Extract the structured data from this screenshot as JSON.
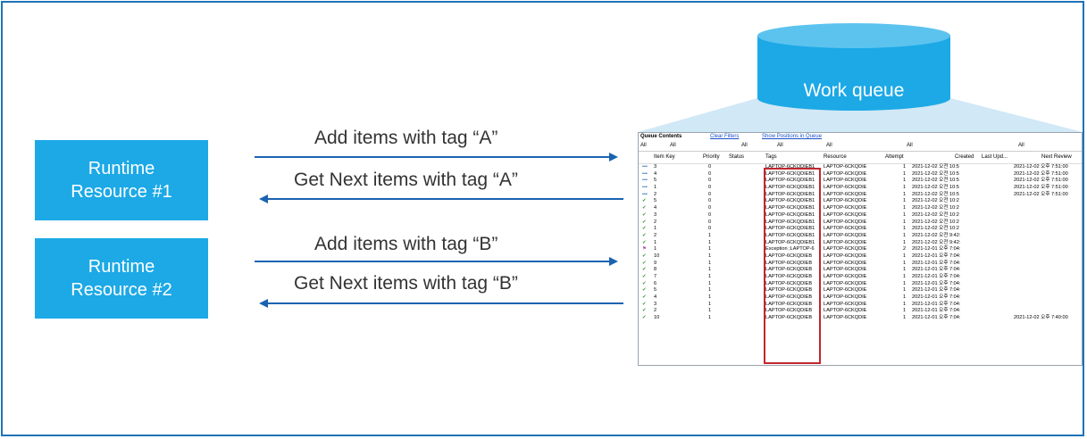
{
  "resources": [
    {
      "label_line1": "Runtime",
      "label_line2": "Resource #1"
    },
    {
      "label_line1": "Runtime",
      "label_line2": "Resource #2"
    }
  ],
  "arrows": [
    {
      "label": "Add items with tag “A”",
      "direction": "right"
    },
    {
      "label": "Get Next items with tag “A”",
      "direction": "left"
    },
    {
      "label": "Add items with tag “B”",
      "direction": "right"
    },
    {
      "label": "Get Next items with tag “B”",
      "direction": "left"
    }
  ],
  "queue": {
    "title": "Work queue",
    "window": {
      "heading": "Queue Contents",
      "clear_filters": "Clear Filters",
      "show_positions": "Show Positions in Queue",
      "filter_all": "All",
      "columns": [
        "Item Key",
        "Priority",
        "Status",
        "Tags",
        "Resource",
        "Attempt",
        "Created",
        "Last Upd...",
        "Next Review"
      ],
      "rows": [
        {
          "icon": "dots",
          "key": "3",
          "priority": "0",
          "tags": "LAPTOP-6CKQDIEB1",
          "resource": "LAPTOP-6CKQDIE",
          "attempt": "1",
          "created": "2021-12-02 오전 10:5",
          "next": "2021-12-02 오후 7:51:00"
        },
        {
          "icon": "dots",
          "key": "4",
          "priority": "0",
          "tags": "LAPTOP-6CKQDIEB1",
          "resource": "LAPTOP-6CKQDIE",
          "attempt": "1",
          "created": "2021-12-02 오전 10:5",
          "next": "2021-12-02 오후 7:51:00"
        },
        {
          "icon": "dots",
          "key": "5",
          "priority": "0",
          "tags": "LAPTOP-6CKQDIEB1",
          "resource": "LAPTOP-6CKQDIE",
          "attempt": "1",
          "created": "2021-12-02 오전 10:5",
          "next": "2021-12-02 오후 7:51:00"
        },
        {
          "icon": "dots",
          "key": "1",
          "priority": "0",
          "tags": "LAPTOP-6CKQDIEB1",
          "resource": "LAPTOP-6CKQDIE",
          "attempt": "1",
          "created": "2021-12-02 오전 10:5",
          "next": "2021-12-02 오후 7:51:00"
        },
        {
          "icon": "dots",
          "key": "2",
          "priority": "0",
          "tags": "LAPTOP-6CKQDIEB1",
          "resource": "LAPTOP-6CKQDIE",
          "attempt": "1",
          "created": "2021-12-02 오전 10:5",
          "next": "2021-12-02 오후 7:51:00"
        },
        {
          "icon": "check",
          "key": "5",
          "priority": "0",
          "tags": "LAPTOP-6CKQDIEB1",
          "resource": "LAPTOP-6CKQDIE",
          "attempt": "1",
          "created": "2021-12-02 오전 10:2",
          "next": ""
        },
        {
          "icon": "check",
          "key": "4",
          "priority": "0",
          "tags": "LAPTOP-6CKQDIEB1",
          "resource": "LAPTOP-6CKQDIE",
          "attempt": "1",
          "created": "2021-12-02 오전 10:2",
          "next": ""
        },
        {
          "icon": "check",
          "key": "3",
          "priority": "0",
          "tags": "LAPTOP-6CKQDIEB1",
          "resource": "LAPTOP-6CKQDIE",
          "attempt": "1",
          "created": "2021-12-02 오전 10:2",
          "next": ""
        },
        {
          "icon": "check",
          "key": "2",
          "priority": "0",
          "tags": "LAPTOP-6CKQDIEB1",
          "resource": "LAPTOP-6CKQDIE",
          "attempt": "1",
          "created": "2021-12-02 오전 10:2",
          "next": ""
        },
        {
          "icon": "check",
          "key": "1",
          "priority": "0",
          "tags": "LAPTOP-6CKQDIEB1",
          "resource": "LAPTOP-6CKQDIE",
          "attempt": "1",
          "created": "2021-12-02 오전 10:2",
          "next": ""
        },
        {
          "icon": "check",
          "key": "2",
          "priority": "1",
          "tags": "LAPTOP-6CKQDIEB1",
          "resource": "LAPTOP-6CKQDIE",
          "attempt": "1",
          "created": "2021-12-02 오전 9:42:",
          "next": ""
        },
        {
          "icon": "check",
          "key": "1",
          "priority": "1",
          "tags": "LAPTOP-6CKQDIEB1",
          "resource": "LAPTOP-6CKQDIE",
          "attempt": "1",
          "created": "2021-12-02 오전 9:42:",
          "next": ""
        },
        {
          "icon": "flag",
          "key": "1",
          "priority": "1",
          "tags": "Exception ;LAPTOP-6",
          "resource": "LAPTOP-6CKQDIE",
          "attempt": "2",
          "created": "2021-12-01 오후 7:04:",
          "next": ""
        },
        {
          "icon": "check",
          "key": "10",
          "priority": "1",
          "tags": "LAPTOP-6CKQDIEB",
          "resource": "LAPTOP-6CKQDIE",
          "attempt": "1",
          "created": "2021-12-01 오후 7:04:",
          "next": ""
        },
        {
          "icon": "check",
          "key": "9",
          "priority": "1",
          "tags": "LAPTOP-6CKQDIEB",
          "resource": "LAPTOP-6CKQDIE",
          "attempt": "1",
          "created": "2021-12-01 오후 7:04:",
          "next": ""
        },
        {
          "icon": "check",
          "key": "8",
          "priority": "1",
          "tags": "LAPTOP-6CKQDIEB",
          "resource": "LAPTOP-6CKQDIE",
          "attempt": "1",
          "created": "2021-12-01 오후 7:04:",
          "next": ""
        },
        {
          "icon": "check",
          "key": "7",
          "priority": "1",
          "tags": "LAPTOP-6CKQDIEB",
          "resource": "LAPTOP-6CKQDIE",
          "attempt": "1",
          "created": "2021-12-01 오후 7:04:",
          "next": ""
        },
        {
          "icon": "check",
          "key": "6",
          "priority": "1",
          "tags": "LAPTOP-6CKQDIEB",
          "resource": "LAPTOP-6CKQDIE",
          "attempt": "1",
          "created": "2021-12-01 오후 7:04:",
          "next": ""
        },
        {
          "icon": "check",
          "key": "5",
          "priority": "1",
          "tags": "LAPTOP-6CKQDIEB",
          "resource": "LAPTOP-6CKQDIE",
          "attempt": "1",
          "created": "2021-12-01 오후 7:04:",
          "next": ""
        },
        {
          "icon": "check",
          "key": "4",
          "priority": "1",
          "tags": "LAPTOP-6CKQDIEB",
          "resource": "LAPTOP-6CKQDIE",
          "attempt": "1",
          "created": "2021-12-01 오후 7:04:",
          "next": ""
        },
        {
          "icon": "check",
          "key": "3",
          "priority": "1",
          "tags": "LAPTOP-6CKQDIEB",
          "resource": "LAPTOP-6CKQDIE",
          "attempt": "1",
          "created": "2021-12-01 오후 7:04:",
          "next": ""
        },
        {
          "icon": "check",
          "key": "2",
          "priority": "1",
          "tags": "LAPTOP-6CKQDIEB",
          "resource": "LAPTOP-6CKQDIE",
          "attempt": "1",
          "created": "2021-12-01 오후 7:04:",
          "next": ""
        },
        {
          "icon": "check",
          "key": "10",
          "priority": "1",
          "tags": "LAPTOP-6CKQDIEB",
          "resource": "LAPTOP-6CKQDIE",
          "attempt": "1",
          "created": "2021-12-01 오후 7:04:",
          "next": "2021-12-02 오후 7:40:00"
        }
      ]
    }
  },
  "colors": {
    "frame": "#1f73b7",
    "resource_box": "#1ca9e6",
    "arrow": "#1a63b0",
    "cylinder": "#1ca9e6",
    "highlight": "#c0272d"
  }
}
